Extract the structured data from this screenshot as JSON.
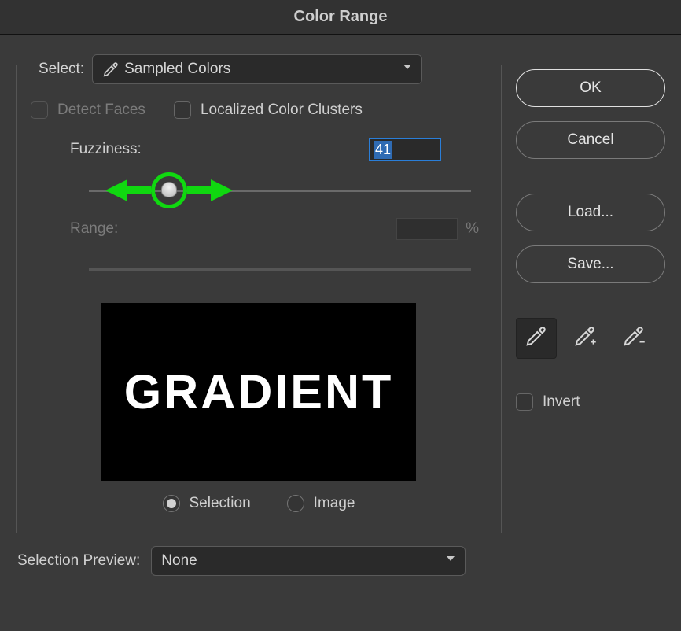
{
  "title": "Color Range",
  "select": {
    "label": "Select:",
    "value": "Sampled Colors"
  },
  "options": {
    "detect_faces": "Detect Faces",
    "localized": "Localized Color Clusters"
  },
  "fuzziness": {
    "label": "Fuzziness:",
    "value": "41",
    "thumb_pct": 21
  },
  "range": {
    "label": "Range:",
    "unit": "%"
  },
  "preview_text": "GRADIENT",
  "radios": {
    "selection": "Selection",
    "image": "Image"
  },
  "selection_preview": {
    "label": "Selection Preview:",
    "value": "None"
  },
  "buttons": {
    "ok": "OK",
    "cancel": "Cancel",
    "load": "Load...",
    "save": "Save..."
  },
  "invert": {
    "label": "Invert"
  },
  "icons": {
    "eyedropper": "eyedropper",
    "eyedropper_plus": "eyedropper-plus",
    "eyedropper_minus": "eyedropper-minus",
    "chevron": "chevron-down"
  }
}
